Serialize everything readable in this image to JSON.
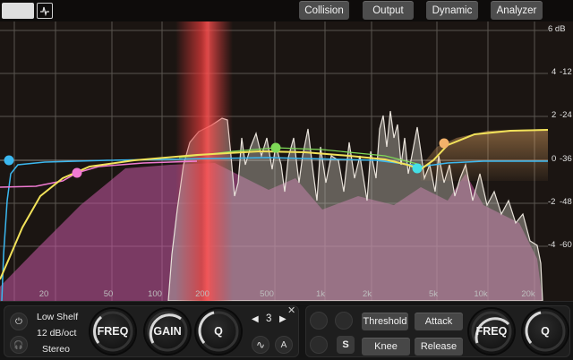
{
  "top_tabs": [
    "Collision",
    "Output",
    "Dynamic",
    "Analyzer"
  ],
  "db_labels": [
    {
      "gain": "6 dB",
      "analyzer": ""
    },
    {
      "gain": "4",
      "analyzer": "-12"
    },
    {
      "gain": "2",
      "analyzer": "-24"
    },
    {
      "gain": "0",
      "analyzer": "-36"
    },
    {
      "gain": "-2",
      "analyzer": "-48"
    },
    {
      "gain": "-4",
      "analyzer": "-60"
    }
  ],
  "freq_labels": [
    "20",
    "50",
    "100",
    "200",
    "500",
    "1k",
    "2k",
    "5k",
    "10k",
    "20k"
  ],
  "band": {
    "filter_type": "Low Shelf",
    "slope": "12 dB/oct",
    "channel": "Stereo",
    "number": "3",
    "knobs": [
      "FREQ",
      "GAIN",
      "Q"
    ],
    "prev": "◀",
    "next": "▶",
    "close": "✕",
    "power_icon": "⏻",
    "headphone_icon": "🎧",
    "wave_icon": "∿",
    "auto_icon": "A"
  },
  "dynamics": {
    "threshold": "Threshold",
    "attack": "Attack",
    "knee": "Knee",
    "release": "Release",
    "solo": "S",
    "knobs": [
      "FREQ",
      "Q"
    ]
  },
  "colors": {
    "accent_yellow": "#f2e25a",
    "node_blue": "#3bb8f0",
    "node_pink": "#f07ad2",
    "node_green": "#7ed957",
    "node_cyan": "#44e0e6",
    "node_orange": "#f3b26a",
    "collision_red": "#e03a3a"
  }
}
